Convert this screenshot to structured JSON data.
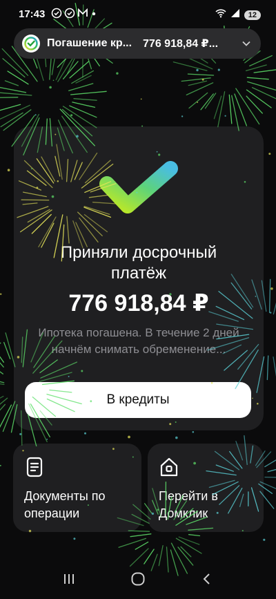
{
  "status_bar": {
    "time": "17:43",
    "battery": "12",
    "icons": [
      "check-circle-icon",
      "check-circle-icon",
      "mail-icon",
      "dot-icon",
      "wifi-icon",
      "signal-icon"
    ]
  },
  "notification": {
    "title": "Погашение кр...",
    "amount": "776 918,84 ₽..."
  },
  "result": {
    "title": "Приняли досрочный платёж",
    "amount": "776 918,84 ₽",
    "description": "Ипотека погашена. В течение 2 дней начнём снимать обременение..."
  },
  "actions": {
    "primary_label": "В кредиты",
    "documents_label": "Документы по операции",
    "domclick_label": "Перейти в Домклик"
  },
  "colors": {
    "background": "#0b0b0c",
    "card": "#1f1f21",
    "check_gradient_start": "#b6e22b",
    "check_gradient_end": "#4fc3d9",
    "muted_text": "#8e8e93",
    "firework_green": "#5ee06a",
    "firework_teal": "#5ad0d6",
    "firework_yellow": "#e8e65a"
  }
}
